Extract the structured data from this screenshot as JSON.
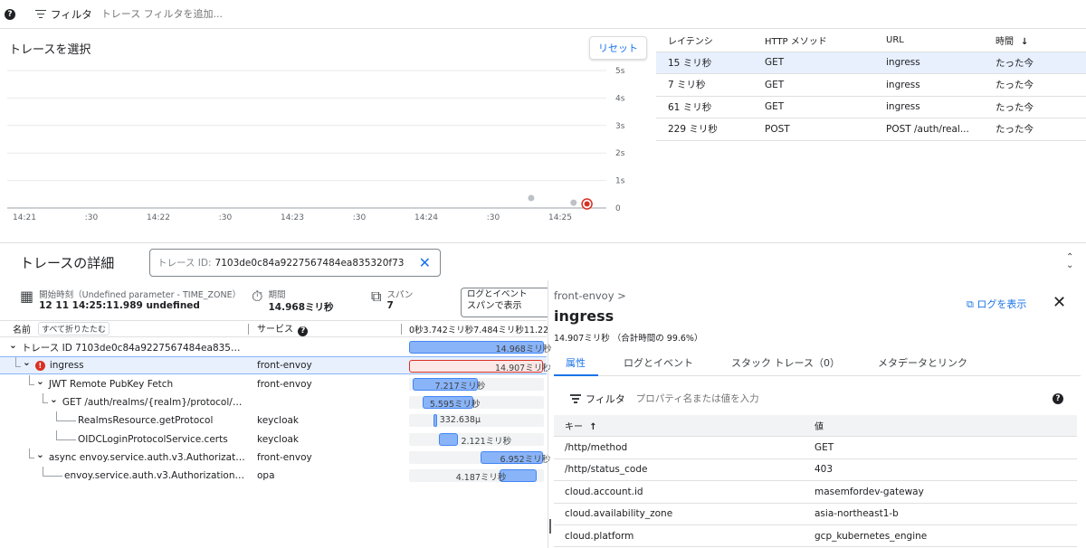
{
  "filter_bar": {
    "help": "?",
    "label": "フィルタ",
    "placeholder": "トレース フィルタを追加..."
  },
  "chart": {
    "title": "トレースを選択",
    "reset_label": "リセット",
    "y_ticks": [
      "0",
      "1s",
      "2s",
      "3s",
      "4s",
      "5s"
    ],
    "x_ticks": [
      "14:21",
      ":30",
      "14:22",
      ":30",
      "14:23",
      ":30",
      "14:24",
      ":30",
      "14:25"
    ]
  },
  "chart_data": {
    "type": "scatter",
    "title": "トレースを選択",
    "xlabel": "",
    "ylabel": "",
    "x_ticks": [
      "14:21",
      ":30",
      "14:22",
      ":30",
      "14:23",
      ":30",
      "14:24",
      ":30",
      "14:25"
    ],
    "y_ticks": [
      "0",
      "1s",
      "2s",
      "3s",
      "4s",
      "5s"
    ],
    "ylim": [
      0,
      5
    ],
    "grid": true,
    "points": [
      {
        "x": "14:24:47",
        "y": 0.229,
        "selected": false
      },
      {
        "x": "14:25:06",
        "y": 0.061,
        "selected": false
      },
      {
        "x": "14:25:12",
        "y": 0.007,
        "selected": false
      },
      {
        "x": "14:25:12",
        "y": 0.015,
        "selected": true
      }
    ],
    "colors": {
      "point": "#bdc1c6",
      "selected": "#d93025"
    }
  },
  "trace_list": {
    "headers": {
      "latency": "レイテンシ",
      "method": "HTTP メソッド",
      "url": "URL",
      "time": "時間",
      "sort_icon": "arrow-down"
    },
    "rows": [
      {
        "latency": "15 ミリ秒",
        "method": "GET",
        "url": "ingress",
        "time": "たった今",
        "selected": true
      },
      {
        "latency": "7 ミリ秒",
        "method": "GET",
        "url": "ingress",
        "time": "たった今",
        "selected": false
      },
      {
        "latency": "61 ミリ秒",
        "method": "GET",
        "url": "ingress",
        "time": "たった今",
        "selected": false
      },
      {
        "latency": "229 ミリ秒",
        "method": "POST",
        "url": "POST /auth/real...",
        "time": "たった今",
        "selected": false
      }
    ]
  },
  "details": {
    "title": "トレースの詳細",
    "trace_id_label": "トレース ID:",
    "trace_id_value": "7103de0c84a9227567484ea835320f73",
    "start_label": "開始時刻（Undefined parameter - TIME_ZONE）",
    "start_value": "12 11 14:25:11.989 undefined",
    "duration_label": "期間",
    "duration_value": "14.968ミリ秒",
    "spans_label": "スパン",
    "spans_value": "7",
    "log_box_line1": "ログとイベント",
    "log_box_line2": "スパンで表示"
  },
  "span_tree": {
    "col_name": "名前",
    "collapse_all": "すべて折りたたむ",
    "col_service": "サービス",
    "timeline_ticks": "0秒3.742ミリ秒7.484ミリ秒11.22",
    "total_ms": 14.968,
    "rows": [
      {
        "name": "トレース ID 7103de0c84a9227567484ea835320f...",
        "service": "",
        "start": 0,
        "duration": 14.968,
        "label": "14.968ミリ秒",
        "depth": 0,
        "expanded": true,
        "error": false,
        "selected": false
      },
      {
        "name": "ingress",
        "service": "front-envoy",
        "start": 0,
        "duration": 14.907,
        "label": "14.907ミリ秒",
        "depth": 1,
        "expanded": true,
        "error": true,
        "selected": true
      },
      {
        "name": "JWT Remote PubKey Fetch",
        "service": "front-envoy",
        "start": 0.45,
        "duration": 7.217,
        "label": "7.217ミリ秒",
        "depth": 2,
        "expanded": true,
        "error": false,
        "selected": false
      },
      {
        "name": "GET /auth/realms/{realm}/protocol/{pr...",
        "service": "",
        "start": 1.5,
        "duration": 5.595,
        "label": "5.595ミリ秒",
        "depth": 3,
        "expanded": true,
        "error": false,
        "selected": false
      },
      {
        "name": "RealmsResource.getProtocol",
        "service": "keycloak",
        "start": 2.75,
        "duration": 0.333,
        "label": "332.638μ",
        "depth": 4,
        "expanded": false,
        "error": false,
        "selected": false
      },
      {
        "name": "OIDCLoginProtocolService.certs",
        "service": "keycloak",
        "start": 3.35,
        "duration": 2.121,
        "label": "2.121ミリ秒",
        "depth": 4,
        "expanded": false,
        "error": false,
        "selected": false
      },
      {
        "name": "async envoy.service.auth.v3.Authorization....",
        "service": "front-envoy",
        "start": 7.95,
        "duration": 6.952,
        "label": "6.952ミリ秒",
        "depth": 2,
        "expanded": true,
        "error": false,
        "selected": false
      },
      {
        "name": "envoy.service.auth.v3.Authorization/Ch...",
        "service": "opa",
        "start": 10.0,
        "duration": 4.187,
        "label": "4.187ミリ秒",
        "depth": 3,
        "expanded": false,
        "error": false,
        "selected": false
      }
    ]
  },
  "span_panel": {
    "breadcrumb": "front-envoy >",
    "title": "ingress",
    "subtitle": "14.907ミリ秒 （合計時間の 99.6%）",
    "view_logs": "ログを表示",
    "tabs": [
      "属性",
      "ログとイベント",
      "スタック トレース（0）",
      "メタデータとリンク"
    ],
    "filter_label": "フィルタ",
    "filter_placeholder": "プロパティ名または値を入力",
    "key_header": "キー",
    "value_header": "値",
    "attributes": [
      {
        "key": "/http/method",
        "value": "GET"
      },
      {
        "key": "/http/status_code",
        "value": "403"
      },
      {
        "key": "cloud.account.id",
        "value": "masemfordev-gateway"
      },
      {
        "key": "cloud.availability_zone",
        "value": "asia-northeast1-b"
      },
      {
        "key": "cloud.platform",
        "value": "gcp_kubernetes_engine"
      }
    ]
  }
}
